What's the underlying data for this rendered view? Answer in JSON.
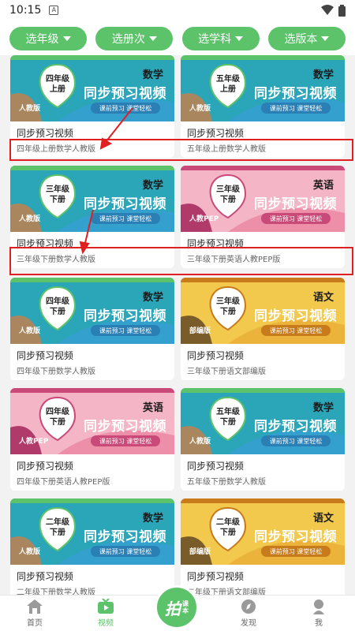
{
  "status_bar": {
    "time": "10:15",
    "sim_glyph": "A"
  },
  "filters": [
    {
      "label": "选年级"
    },
    {
      "label": "选册次"
    },
    {
      "label": "选学科"
    },
    {
      "label": "选版本"
    }
  ],
  "cards": [
    {
      "grade": "四年级",
      "volume": "上册",
      "subject": "数学",
      "edition": "人教版",
      "heading": "同步预习视频",
      "tagline": "课前预习 课堂轻松",
      "theme": "teal",
      "title": "同步预习视频",
      "desc": "四年级上册数学人教版"
    },
    {
      "grade": "五年级",
      "volume": "上册",
      "subject": "数学",
      "edition": "人教版",
      "heading": "同步预习视频",
      "tagline": "课前预习 课堂轻松",
      "theme": "teal",
      "title": "同步预习视频",
      "desc": "五年级上册数学人教版"
    },
    {
      "grade": "三年级",
      "volume": "下册",
      "subject": "数学",
      "edition": "人教版",
      "heading": "同步预习视频",
      "tagline": "课前预习 课堂轻松",
      "theme": "teal",
      "title": "同步预习视频",
      "desc": "三年级下册数学人教版"
    },
    {
      "grade": "三年级",
      "volume": "下册",
      "subject": "英语",
      "edition": "人教PEP",
      "heading": "同步预习视频",
      "tagline": "课前预习 课堂轻松",
      "theme": "pink",
      "title": "同步预习视频",
      "desc": "三年级下册英语人教PEP版"
    },
    {
      "grade": "四年级",
      "volume": "下册",
      "subject": "数学",
      "edition": "人教版",
      "heading": "同步预习视频",
      "tagline": "课前预习 课堂轻松",
      "theme": "teal",
      "title": "同步预习视频",
      "desc": "四年级下册数学人教版"
    },
    {
      "grade": "三年级",
      "volume": "下册",
      "subject": "语文",
      "edition": "部编版",
      "heading": "同步预习视频",
      "tagline": "课前预习 课堂轻松",
      "theme": "yellow",
      "title": "同步预习视频",
      "desc": "三年级下册语文部编版"
    },
    {
      "grade": "四年级",
      "volume": "下册",
      "subject": "英语",
      "edition": "人教PEP",
      "heading": "同步预习视频",
      "tagline": "课前预习 课堂轻松",
      "theme": "pink",
      "title": "同步预习视频",
      "desc": "四年级下册英语人教PEP版"
    },
    {
      "grade": "五年级",
      "volume": "下册",
      "subject": "数学",
      "edition": "人教版",
      "heading": "同步预习视频",
      "tagline": "课前预习 课堂轻松",
      "theme": "teal",
      "title": "同步预习视频",
      "desc": "五年级下册数学人教版"
    },
    {
      "grade": "二年级",
      "volume": "下册",
      "subject": "数学",
      "edition": "人教版",
      "heading": "同步预习视频",
      "tagline": "课前预习 课堂轻松",
      "theme": "teal",
      "title": "同步预习视频",
      "desc": "二年级下册数学人教版"
    },
    {
      "grade": "二年级",
      "volume": "下册",
      "subject": "语文",
      "edition": "部编版",
      "heading": "同步预习视频",
      "tagline": "课前预习 课堂轻松",
      "theme": "yellow",
      "title": "同步预习视频",
      "desc": "二年级下册语文部编版"
    }
  ],
  "themes": {
    "teal": {
      "bg": "#2ba6b8",
      "accent": "#3d9be0",
      "stripe": "#5cc36a",
      "edition_bg": "#a9865e",
      "tag_bg": "#2a7fb5"
    },
    "pink": {
      "bg": "#f4b6c6",
      "accent": "#e86f92",
      "stripe": "#c94a78",
      "edition_bg": "#b03a6a",
      "tag_bg": "#c94a78"
    },
    "yellow": {
      "bg": "#f2c94c",
      "accent": "#e8a02c",
      "stripe": "#c77b1a",
      "edition_bg": "#7a5c2a",
      "tag_bg": "#c77b1a"
    }
  },
  "bottom_nav": [
    {
      "label": "首页",
      "icon": "home-icon",
      "active": false
    },
    {
      "label": "视频",
      "icon": "tv-icon",
      "active": true
    },
    {
      "label": "发现",
      "icon": "compass-icon",
      "active": false
    },
    {
      "label": "我",
      "icon": "person-icon",
      "active": false
    }
  ],
  "center_button": {
    "main": "拍",
    "sub1": "课",
    "sub2": "本"
  },
  "colors": {
    "brand_green": "#5cc36a",
    "highlight_red": "#e02020"
  }
}
